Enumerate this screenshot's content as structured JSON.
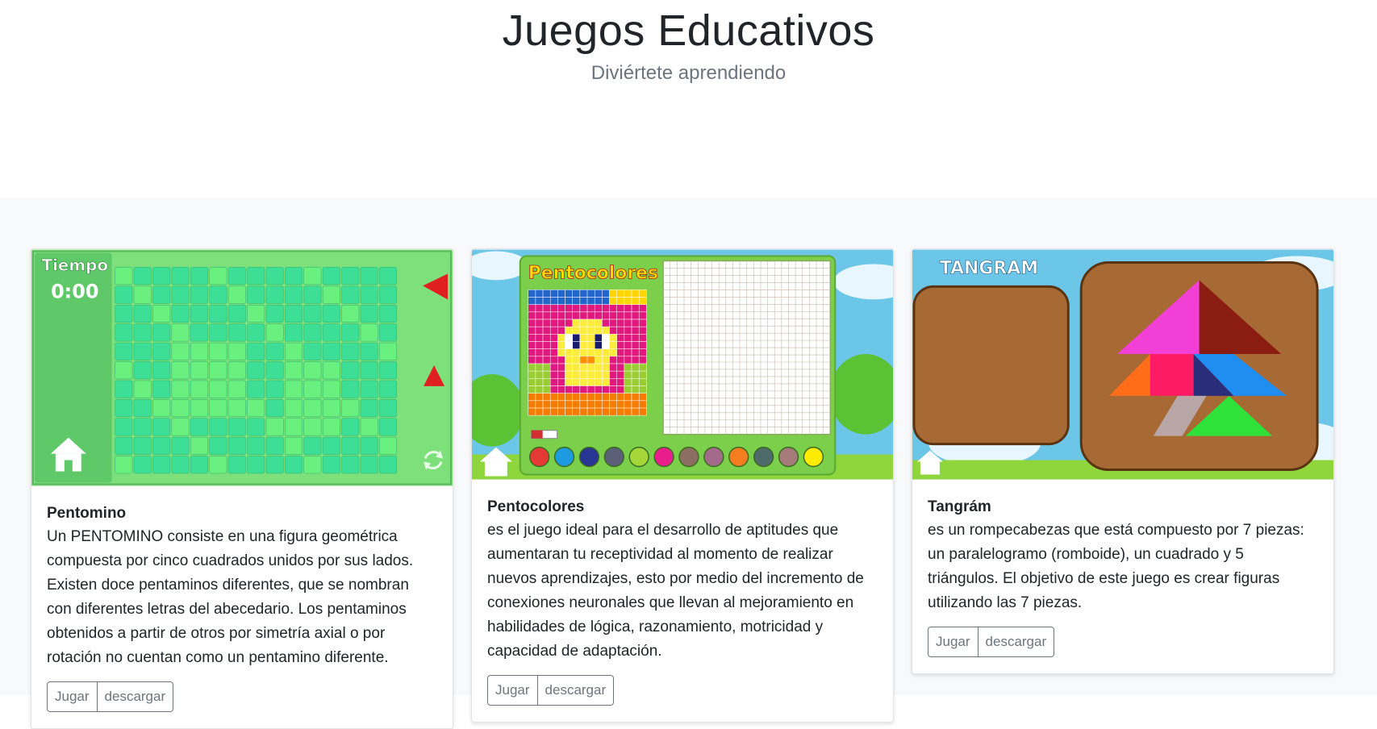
{
  "header": {
    "title": "Juegos Educativos",
    "subtitle": "Diviértete aprendiendo"
  },
  "cards": [
    {
      "title": "Pentomino",
      "text": "Un PENTOMINO consiste en una figura geométrica compuesta por cinco cuadrados unidos por sus lados. Existen doce pentaminos diferentes, que se nombran con diferentes letras del abecedario. Los pentaminos obtenidos a partir de otros por simetría axial o por rotación no cuentan como un pentamino diferente.",
      "play_label": "Jugar",
      "download_label": "descargar",
      "thumb": {
        "label": "Tiempo",
        "time": "0:00",
        "bg": "#7ee07a",
        "tile": "#3fe097"
      }
    },
    {
      "title": "Pentocolores",
      "text": "es el juego ideal para el desarrollo de aptitudes que aumentaran tu receptividad al momento de realizar nuevos aprendizajes, esto por medio del incremento de conexiones neuronales que llevan al mejoramiento en habilidades de lógica, razonamiento, motricidad y capacidad de adaptación.",
      "play_label": "Jugar",
      "download_label": "descargar",
      "thumb": {
        "label": "Pentocolores",
        "bg": "#6cc6e8"
      }
    },
    {
      "title": "Tangrám",
      "text": "es un rompecabezas que está compuesto por 7 piezas: un paralelogramo (romboide), un cuadrado y 5 triángulos. El objetivo de este juego es crear figuras utilizando las 7 piezas.",
      "play_label": "Jugar",
      "download_label": "descargar",
      "thumb": {
        "label": "TANGRAM",
        "bg": "#6cc6e8"
      }
    }
  ]
}
